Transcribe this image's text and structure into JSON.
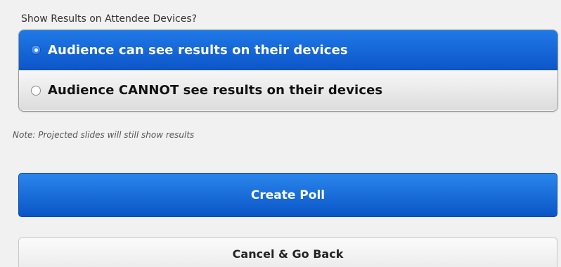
{
  "results_visibility": {
    "label": "Show Results on Attendee Devices?",
    "options": [
      {
        "label": "Audience can see results on their devices",
        "selected": true
      },
      {
        "label": "Audience CANNOT see results on their devices",
        "selected": false
      }
    ],
    "note": "Note: Projected slides will still show results"
  },
  "actions": {
    "create_label": "Create Poll",
    "cancel_label": "Cancel & Go Back"
  },
  "colors": {
    "accent": "#1565d8",
    "background": "#f1f1f1"
  }
}
